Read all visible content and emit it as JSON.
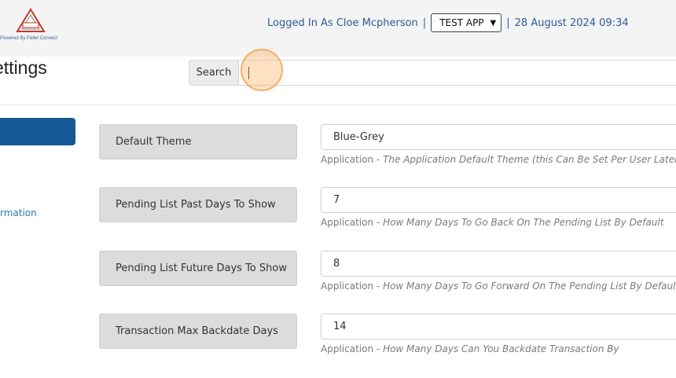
{
  "header": {
    "logo_text": "PALLET CONNECT TEST",
    "logo_tagline": "Powered By Pallet Connect",
    "logged_in_text": "Logged In As Cloe Mcpherson",
    "separator": "|",
    "app_select_value": "TEST APP",
    "datetime": "28 August 2024 09:34"
  },
  "page": {
    "title": "ettings"
  },
  "search": {
    "button_label": "Search",
    "input_value": ""
  },
  "sidebar": {
    "link_label": "rmation"
  },
  "settings": [
    {
      "label": "Default Theme",
      "value": "Blue-Grey",
      "scope": "Application",
      "dash": "-",
      "description": "The Application Default Theme (this Can Be Set Per User Later)"
    },
    {
      "label": "Pending List Past Days To Show",
      "value": "7",
      "scope": "Application",
      "dash": "-",
      "description": "How Many Days To Go Back On The Pending List By Default"
    },
    {
      "label": "Pending List Future Days To Show",
      "value": "8",
      "scope": "Application",
      "dash": "-",
      "description": "How Many Days To Go Forward On The Pending List By Default"
    },
    {
      "label": "Transaction Max Backdate Days",
      "value": "14",
      "scope": "Application",
      "dash": "-",
      "description": "How Many Days Can You Backdate Transaction By"
    }
  ],
  "colors": {
    "primary": "#155a96",
    "link": "#2a78b8",
    "highlight": "#f0a046"
  }
}
